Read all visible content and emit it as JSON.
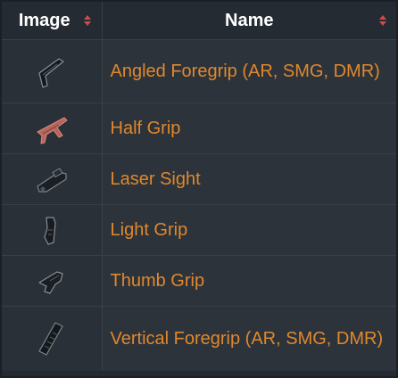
{
  "table": {
    "headers": [
      {
        "label": "Image",
        "sort_icon": "sort-updown-icon"
      },
      {
        "label": "Name",
        "sort_icon": "sort-updown-icon"
      }
    ],
    "rows": [
      {
        "name": "Angled Foregrip (AR, SMG, DMR)",
        "icon": "angled-foregrip-icon"
      },
      {
        "name": "Half Grip",
        "icon": "half-grip-icon"
      },
      {
        "name": "Laser Sight",
        "icon": "laser-sight-icon"
      },
      {
        "name": "Light Grip",
        "icon": "light-grip-icon"
      },
      {
        "name": "Thumb Grip",
        "icon": "thumb-grip-icon"
      },
      {
        "name": "Vertical Foregrip (AR, SMG, DMR)",
        "icon": "vertical-foregrip-icon"
      }
    ]
  },
  "colors": {
    "header_bg": "#252b33",
    "header_text": "#ffffff",
    "link": "#e0882c",
    "sort_arrow": "#d04a4a",
    "image_cell_bg": "#2a3038",
    "name_cell_bg": "#2c333b"
  }
}
